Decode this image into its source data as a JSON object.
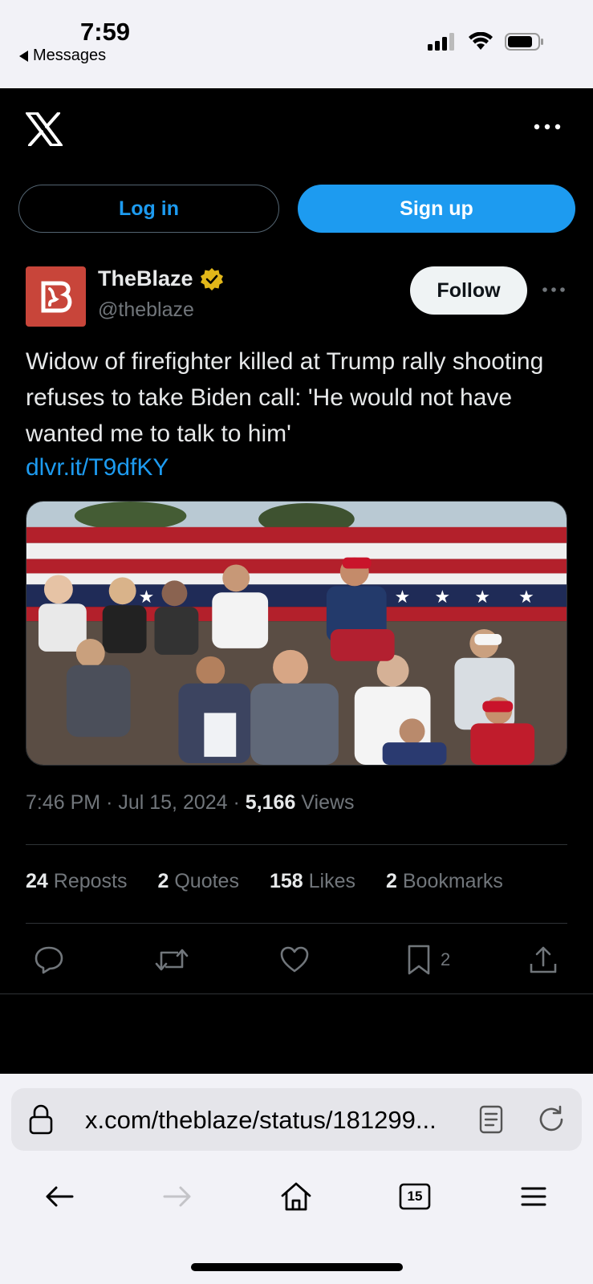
{
  "status_bar": {
    "time": "7:59",
    "back_label": "Messages"
  },
  "header": {
    "logo": "x-logo-icon",
    "more": "more-icon"
  },
  "auth": {
    "login_label": "Log in",
    "signup_label": "Sign up"
  },
  "tweet": {
    "author_name": "TheBlaze",
    "author_handle": "@theblaze",
    "verified": true,
    "follow_label": "Follow",
    "text": "Widow of firefighter killed at Trump rally shooting refuses to take Biden call: 'He would not have wanted me to talk to him'",
    "link": "dlvr.it/T9dfKY",
    "time": "7:46 PM",
    "date": "Jul 15, 2024",
    "views_count": "5,166",
    "views_label": "Views",
    "stats": [
      {
        "count": "24",
        "label": "Reposts"
      },
      {
        "count": "2",
        "label": "Quotes"
      },
      {
        "count": "158",
        "label": "Likes"
      },
      {
        "count": "2",
        "label": "Bookmarks"
      }
    ],
    "bookmark_count": "2"
  },
  "browser": {
    "url": "x.com/theblaze/status/181299...",
    "tab_count": "15"
  },
  "colors": {
    "accent": "#1d9bf0",
    "background": "#000000",
    "muted": "#71767b",
    "avatar": "#c8453a"
  }
}
